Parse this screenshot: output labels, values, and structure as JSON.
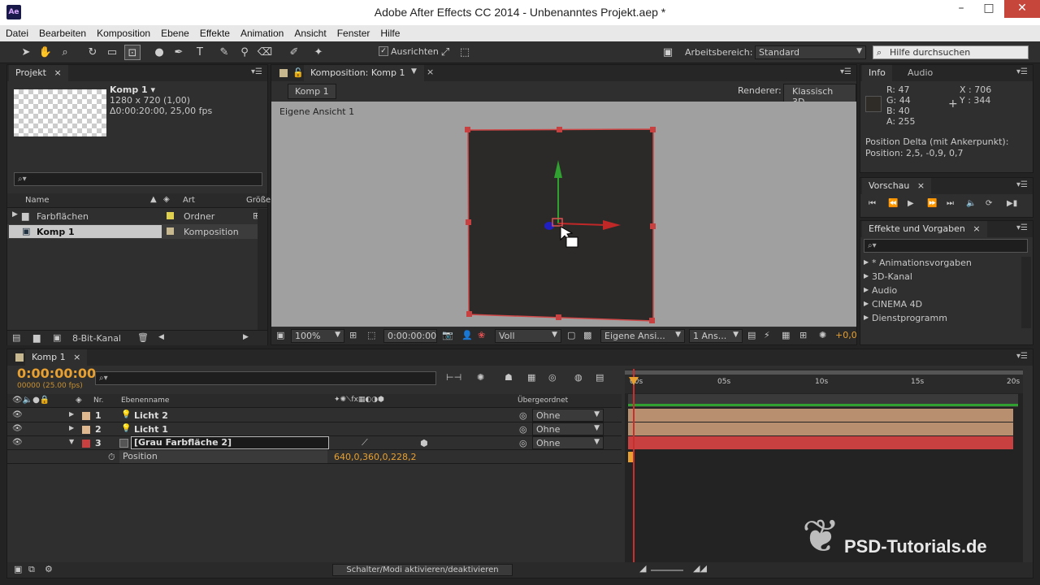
{
  "app": {
    "logo": "Ae",
    "title": "Adobe After Effects CC 2014 - Unbenanntes Projekt.aep *",
    "window_controls": [
      "–",
      "□",
      "✕"
    ]
  },
  "menu": [
    "Datei",
    "Bearbeiten",
    "Komposition",
    "Ebene",
    "Effekte",
    "Animation",
    "Ansicht",
    "Fenster",
    "Hilfe"
  ],
  "toolbar": {
    "ausrichten_label": "Ausrichten",
    "arbeitsbereich_label": "Arbeitsbereich:",
    "arbeitsbereich_value": "Standard",
    "help_search_placeholder": "Hilfe durchsuchen"
  },
  "project": {
    "tab": "Projekt",
    "comp_name": "Komp 1 ▾",
    "comp_size": "1280 x 720 (1,00)",
    "comp_duration": "Δ0:00:20:00, 25,00 fps",
    "columns": {
      "name": "Name",
      "art": "Art",
      "groesse": "Größe"
    },
    "items": [
      {
        "name": "Farbflächen",
        "type": "Ordner",
        "color": "#e0d050"
      },
      {
        "name": "Komp 1",
        "type": "Komposition",
        "color": "#c8b890"
      }
    ],
    "bit_depth": "8-Bit-Kanal"
  },
  "composition": {
    "tab": "Komposition: Komp 1",
    "breadcrumb": "Komp 1",
    "renderer_label": "Renderer:",
    "renderer_value": "Klassisch 3D",
    "view_label": "Eigene Ansicht 1",
    "zoom": "100%",
    "timecode": "0:00:00:00",
    "resolution": "Voll",
    "view_mode": "Eigene Ansi...",
    "view_count": "1 Ans...",
    "exposure": "+0,0"
  },
  "info": {
    "tabs": [
      "Info",
      "Audio"
    ],
    "r": "R: 47",
    "g": "G: 44",
    "b": "B: 40",
    "a": "A: 255",
    "x": "X : 706",
    "y": "Y : 344",
    "position_delta_label": "Position Delta (mit Ankerpunkt):",
    "position_value": "Position: 2,5, -0,9, 0,7"
  },
  "preview": {
    "tab": "Vorschau"
  },
  "effects": {
    "tab": "Effekte und Vorgaben",
    "items": [
      "* Animationsvorgaben",
      "3D-Kanal",
      "Audio",
      "CINEMA 4D",
      "Dienstprogramm"
    ]
  },
  "timeline": {
    "tab": "Komp 1",
    "timecode": "0:00:00:00",
    "frame_info": "00000 (25.00 fps)",
    "columns": {
      "nr": "Nr.",
      "ebenenname": "Ebenenname",
      "uebergeordnet": "Übergeordnet"
    },
    "ruler": [
      "00s",
      "05s",
      "10s",
      "15s",
      "20s"
    ],
    "layers": [
      {
        "nr": "1",
        "name": "Licht 2",
        "parent": "Ohne",
        "color": "#e0b890"
      },
      {
        "nr": "2",
        "name": "Licht 1",
        "parent": "Ohne",
        "color": "#e0b890"
      },
      {
        "nr": "3",
        "name": "[Grau Farbfläche 2]",
        "parent": "Ohne",
        "color": "#c84040"
      }
    ],
    "property_name": "Position",
    "property_value": "640,0,360,0,228,2",
    "toggle_button": "Schalter/Modi aktivieren/deaktivieren"
  },
  "watermark": "PSD-Tutorials.de"
}
